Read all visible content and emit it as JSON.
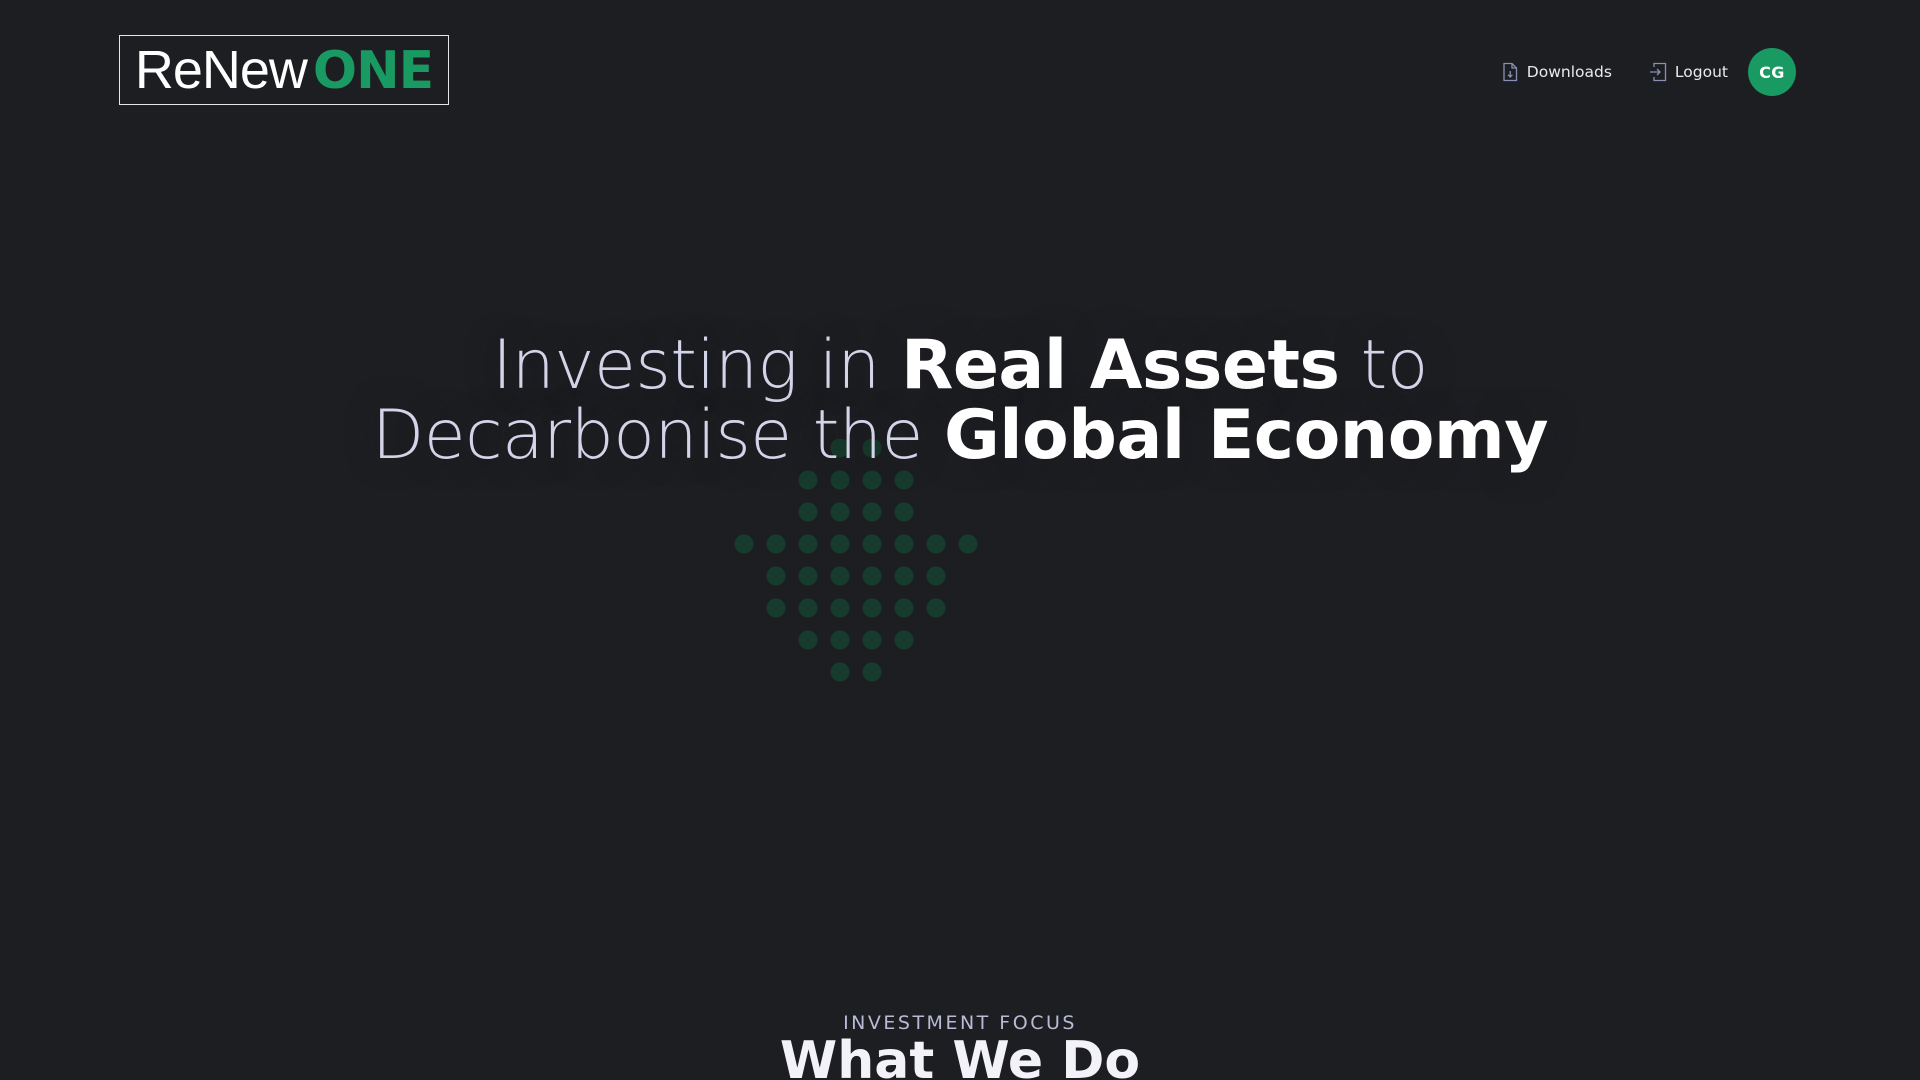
{
  "header": {
    "logo": {
      "part1": "ReNew",
      "part2": "ONE"
    },
    "nav": {
      "downloads_label": "Downloads",
      "logout_label": "Logout"
    },
    "avatar_initials": "CG"
  },
  "hero": {
    "line1": {
      "light": "Investing in ",
      "bold": "Real Assets",
      "tail": " to"
    },
    "line2": {
      "light": "Decarbonise the ",
      "bold": "Global Economy"
    }
  },
  "section": {
    "eyebrow": "INVESTMENT FOCUS",
    "title": "What We Do"
  },
  "icons": {
    "downloads": "document-icon",
    "logout": "logout-icon",
    "hero_pattern": "dot-pattern-icon"
  },
  "colors": {
    "background": "#1d1e22",
    "brand_green": "#1a9a63",
    "dot_green": "#173b2d",
    "hero_light_text": "#d3d4e8",
    "eyebrow_text": "#b9bad6"
  }
}
